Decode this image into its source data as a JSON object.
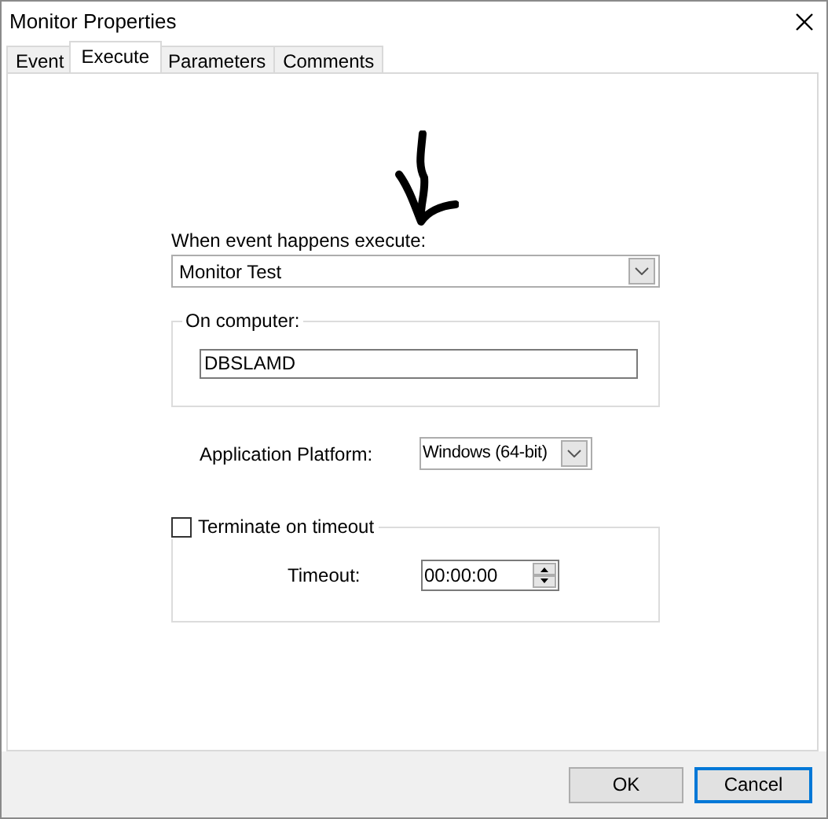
{
  "window": {
    "title": "Monitor Properties"
  },
  "tabs": [
    {
      "label": "Event",
      "selected": false
    },
    {
      "label": "Execute",
      "selected": true
    },
    {
      "label": "Parameters",
      "selected": false
    },
    {
      "label": "Comments",
      "selected": false
    }
  ],
  "execute": {
    "label": "When event happens execute:",
    "value": "Monitor Test"
  },
  "computer_group": {
    "label": "On computer:",
    "value": "DBSLAMD"
  },
  "platform": {
    "label": "Application Platform:",
    "value": "Windows (64-bit)"
  },
  "terminate": {
    "label": "Terminate on timeout",
    "checked": false
  },
  "timeout": {
    "label": "Timeout:",
    "value": "00:00:00"
  },
  "buttons": [
    {
      "label": "OK",
      "default": false
    },
    {
      "label": "Cancel",
      "default": true
    }
  ]
}
